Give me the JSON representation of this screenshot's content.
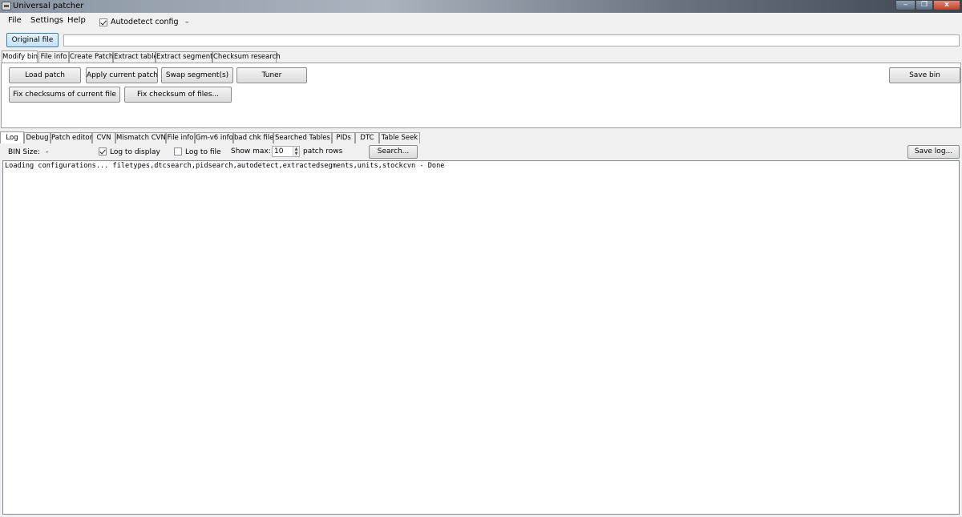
{
  "window": {
    "title": "Universal patcher",
    "minimize_glyph": "‒",
    "maximize_glyph": "❐",
    "close_glyph": "x"
  },
  "menu": {
    "items": [
      "File",
      "Settings",
      "Help"
    ],
    "autodetect_label": "Autodetect config",
    "autodetect_checked": true,
    "status": "–"
  },
  "original_file": {
    "button_label": "Original file",
    "path_value": ""
  },
  "top_tabs": [
    "Modify bin",
    "File info",
    "Create Patch",
    "Extract table",
    "Extract segments",
    "Checksum research"
  ],
  "modify_bin": {
    "load_patch": "Load patch",
    "apply_current_patch": "Apply current patch",
    "swap_segments": "Swap segment(s)",
    "tuner": "Tuner",
    "save_bin": "Save bin",
    "fix_checksums_current": "Fix checksums of current file",
    "fix_checksum_files": "Fix checksum of files..."
  },
  "bottom_tabs": [
    "Log",
    "Debug",
    "Patch editor",
    "CVN",
    "Mismatch CVN",
    "File info",
    "Gm-v6 info",
    "bad chk file",
    "Searched Tables",
    "PIDs",
    "DTC",
    "Table Seek"
  ],
  "log_toolbar": {
    "bin_size_label": "BIN Size:",
    "bin_size_value": "-",
    "log_to_display_label": "Log to display",
    "log_to_display_checked": true,
    "log_to_file_label": "Log to file",
    "log_to_file_checked": false,
    "show_max_label": "Show max:",
    "show_max_value": "10",
    "patch_rows_label": "patch rows",
    "search_button": "Search...",
    "save_log_button": "Save log..."
  },
  "log": {
    "text": "Loading configurations... filetypes,dtcsearch,pidsearch,autodetect,extractedsegments,units,stockcvn - Done"
  },
  "colors": {
    "window_bg": "#f0f0f0",
    "accent_button": "#c4e3f8",
    "close_button": "#c4402a"
  }
}
